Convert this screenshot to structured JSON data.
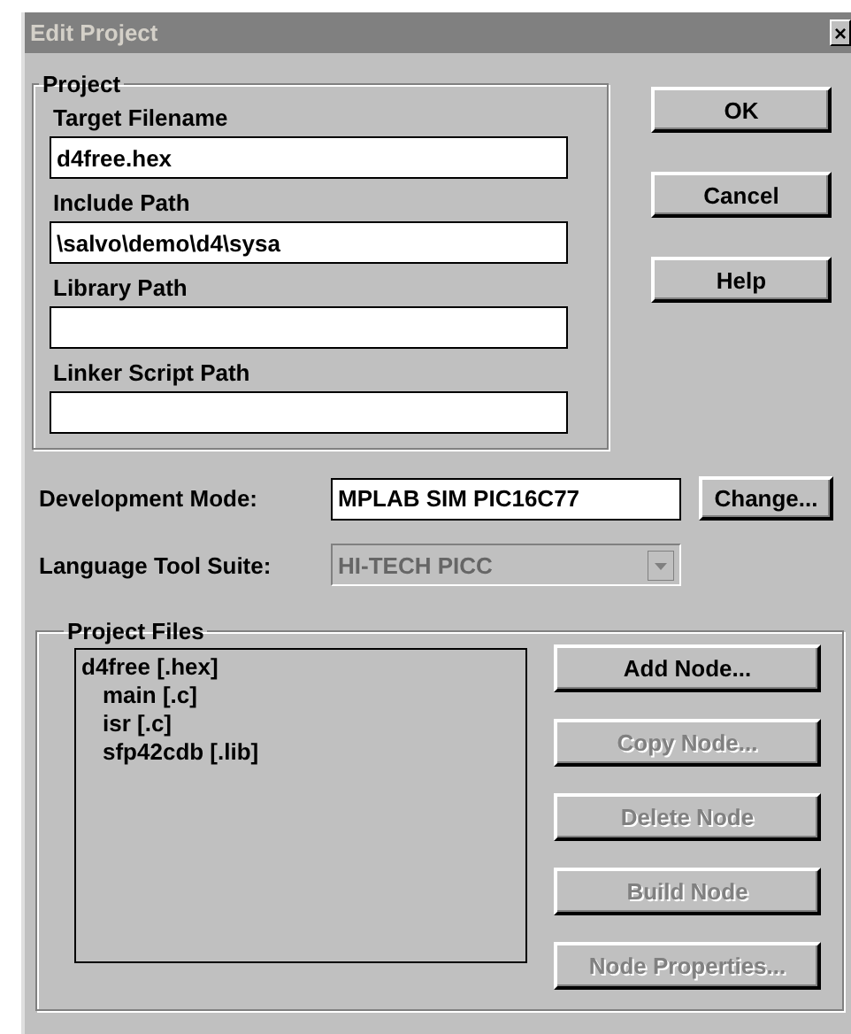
{
  "window": {
    "title": "Edit Project",
    "close": "×"
  },
  "project": {
    "title": "Project",
    "fields": [
      {
        "label": "Target Filename",
        "value": "d4free.hex"
      },
      {
        "label": "Include Path",
        "value": "\\salvo\\demo\\d4\\sysa"
      },
      {
        "label": "Library Path"
      },
      {
        "label": "Linker Script Path"
      }
    ]
  },
  "dialog_buttons": [
    {
      "label": "OK",
      "disabled": false
    },
    {
      "label": "Cancel",
      "disabled": false
    },
    {
      "label": "Help",
      "disabled": false
    }
  ],
  "development_mode": {
    "label": "Development Mode:",
    "value": "MPLAB SIM PIC16C77",
    "button": "Change..."
  },
  "language_tool_suite": {
    "label": "Language Tool Suite:",
    "value": "HI-TECH PICC",
    "disabled": true
  },
  "project_files": {
    "title": "Project Files",
    "tree": [
      {
        "label": "d4free [.hex]",
        "children": [
          {
            "label": "main [.c]"
          },
          {
            "label": "isr [.c]"
          },
          {
            "label": "sfp42cdb [.lib]"
          }
        ]
      }
    ],
    "buttons": [
      {
        "label": "Add Node...",
        "disabled": false
      },
      {
        "label": "Copy Node...",
        "disabled": true
      },
      {
        "label": "Delete Node",
        "disabled": true
      },
      {
        "label": "Build Node",
        "disabled": true
      },
      {
        "label": "Node Properties...",
        "disabled": true
      }
    ]
  }
}
